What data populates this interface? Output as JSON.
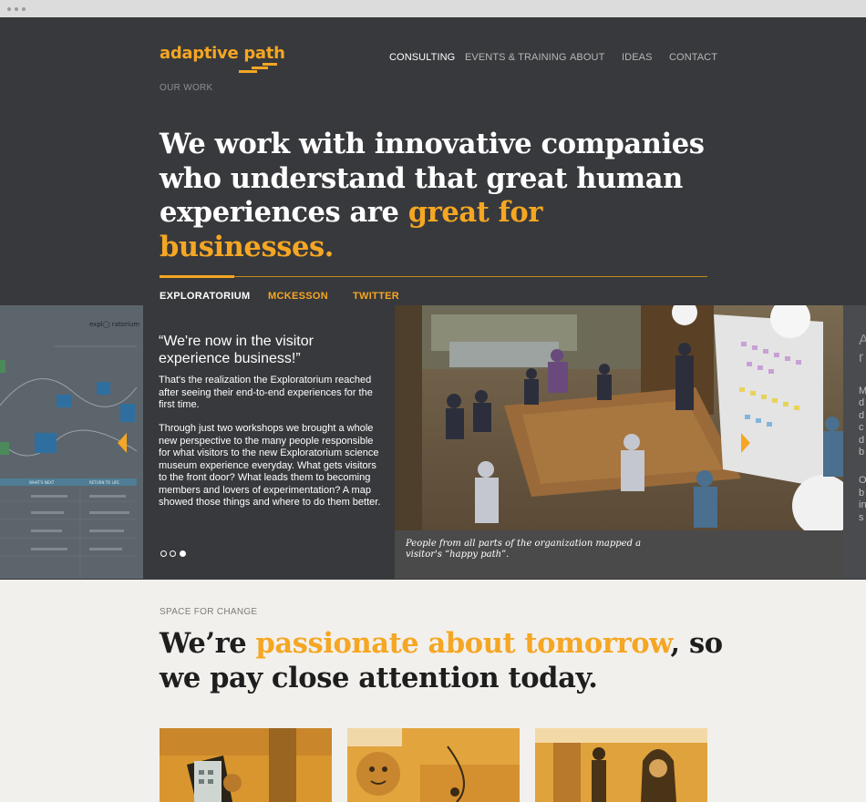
{
  "brand": {
    "name": "adaptive path",
    "accent_color": "#f5a623"
  },
  "nav": {
    "items": [
      {
        "label": "CONSULTING",
        "active": true
      },
      {
        "label": "EVENTS & TRAINING",
        "active": false
      },
      {
        "label": "ABOUT",
        "active": false
      },
      {
        "label": "IDEAS",
        "active": false
      },
      {
        "label": "CONTACT",
        "active": false
      }
    ]
  },
  "our_work": {
    "eyebrow": "OUR WORK",
    "headline_part1": "We work with innovative companies who understand that great human experiences are ",
    "headline_accent": "great for businesses.",
    "tabs": [
      {
        "label": "EXPLORATORIUM",
        "active": true
      },
      {
        "label": "MCKESSON",
        "active": false
      },
      {
        "label": "TWITTER",
        "active": false
      }
    ]
  },
  "case_study": {
    "quote": "“We're now in the visitor experience business!”",
    "paragraph1": "That's the realization the Exploratorium reached after seeing their end-to-end experiences for the first time.",
    "paragraph2": "Through just two workshops we brought a whole new perspective to the many people responsible for what visitors to the new Exploratorium science museum experience everyday. What gets visitors to the front door? What leads them to becoming members and lovers of experimentation? A map showed those things and where to do them better.",
    "photo_caption": "People from all parts of the organization mapped a visitor's “happy path”.",
    "slide_count": 3,
    "active_slide": 3,
    "map_logo_text": "expl◯ ratorium",
    "map_columns": [
      "WHAT'S NEXT",
      "RETURN TO LIFE"
    ],
    "next_slide_peek": [
      "A",
      "r",
      "",
      "M",
      "d",
      "d",
      "c",
      "d",
      "b",
      "",
      "O",
      "b",
      "in",
      "s"
    ]
  },
  "space_for_change": {
    "eyebrow": "SPACE FOR CHANGE",
    "headline_part1": "We’re ",
    "headline_accent": "passionate about tomorrow",
    "headline_part2": ", so we pay close attention today."
  },
  "thumbnails": [
    {
      "subject": "smartphone-in-hand"
    },
    {
      "subject": "baby-with-doctor"
    },
    {
      "subject": "woman-in-store"
    }
  ]
}
